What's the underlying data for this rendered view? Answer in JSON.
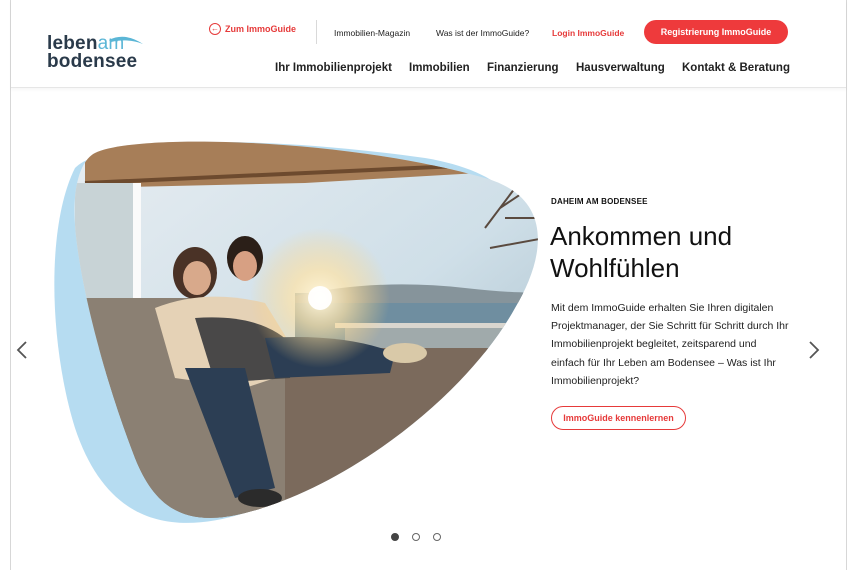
{
  "logo": {
    "part1": "leben",
    "part2": "am",
    "part3": "bodensee"
  },
  "topnav": {
    "back_label": "Zum ImmoGuide",
    "links": [
      "Immobilien-Magazin",
      "Was ist der ImmoGuide?"
    ],
    "login_label": "Login ImmoGuide",
    "register_label": "Registrierung ImmoGuide"
  },
  "mainnav": [
    "Ihr Immobilienprojekt",
    "Immobilien",
    "Finanzierung",
    "Hausverwaltung",
    "Kontakt & Beratung"
  ],
  "hero": {
    "eyebrow": "DAHEIM AM BODENSEE",
    "headline": "Ankommen und Wohlfühlen",
    "body": "Mit dem ImmoGuide erhalten Sie Ihren digitalen Projektmanager, der Sie Schritt für Schritt durch Ihr Immobilienprojekt begleitet, zeitsparend und einfach für Ihr Leben am Bodensee – Was ist Ihr Immobilienprojekt?",
    "cta_label": "ImmoGuide kennenlernen"
  },
  "carousel": {
    "slide_count": 3,
    "active_slide": 1
  },
  "colors": {
    "accent": "#ee3a3c",
    "brand_dark": "#2a3a4a",
    "brand_blue": "#5bb6d6",
    "blob_blue": "#a9d6ef"
  }
}
